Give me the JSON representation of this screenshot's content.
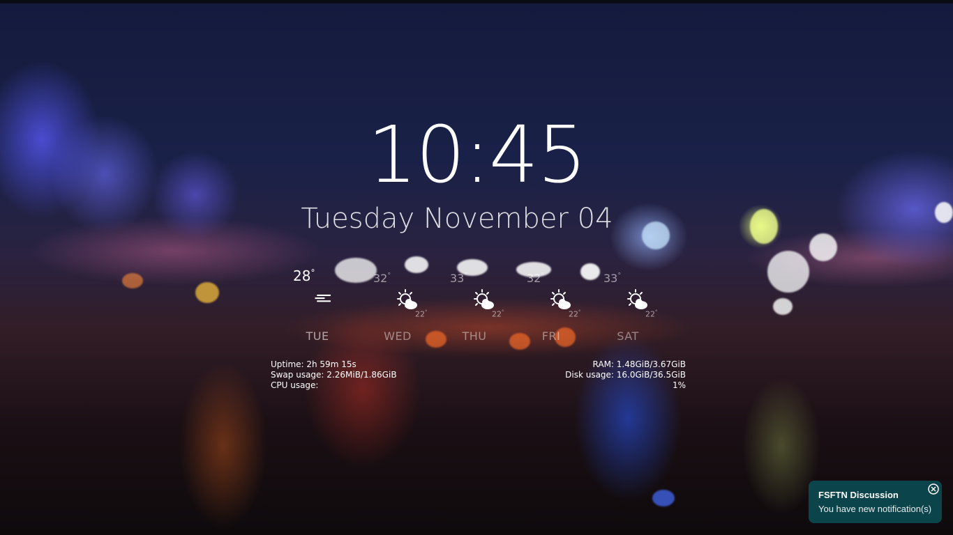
{
  "clock": {
    "time": "10:45"
  },
  "date": {
    "text": "Tuesday November 04"
  },
  "weather": {
    "days": [
      {
        "name": "TUE",
        "high": "28",
        "low": "",
        "icon": "cloudy-lines-icon"
      },
      {
        "name": "WED",
        "high": "32",
        "low": "22",
        "icon": "partly-sunny-icon"
      },
      {
        "name": "THU",
        "high": "33",
        "low": "22",
        "icon": "partly-sunny-icon"
      },
      {
        "name": "FRI",
        "high": "32",
        "low": "22",
        "icon": "partly-sunny-icon"
      },
      {
        "name": "SAT",
        "high": "33",
        "low": "22",
        "icon": "partly-sunny-icon"
      }
    ],
    "degree_symbol": "°"
  },
  "system": {
    "uptime": "Uptime: 2h 59m 15s",
    "swap": "Swap usage: 2.26MiB/1.86GiB",
    "cpu": "CPU usage:",
    "ram": "RAM: 1.48GiB/3.67GiB",
    "disk": "Disk usage: 16.0GiB/36.5GiB",
    "cpu_value": "1%"
  },
  "notification": {
    "title": "FSFTN Discussion",
    "body": "You have new notification(s)"
  },
  "colors": {
    "notification_bg": "#0c4a50",
    "text": "#ffffff"
  }
}
